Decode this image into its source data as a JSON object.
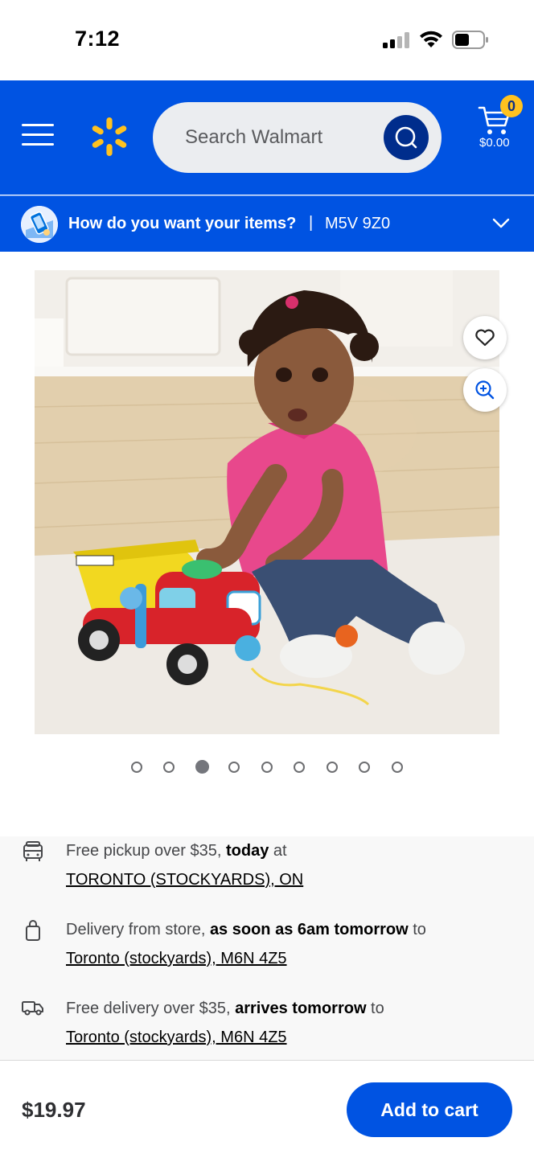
{
  "status_bar": {
    "time": "7:12",
    "battery_level": 0.5
  },
  "header": {
    "search_placeholder": "Search Walmart",
    "cart_count": "0",
    "cart_total": "$0.00",
    "brand_color": "#0053e2",
    "spark_color": "#ffc220"
  },
  "intent": {
    "question": "How do you want your items?",
    "separator": "|",
    "postal_code": "M5V 9Z0"
  },
  "carousel": {
    "total": 9,
    "active_index": 3
  },
  "fulfillment": [
    {
      "icon": "store-pickup-icon",
      "prefix": "Free pickup over $35, ",
      "bold": "today",
      "suffix": " at",
      "link": "TORONTO (STOCKYARDS), ON"
    },
    {
      "icon": "shopping-bag-icon",
      "prefix": "Delivery from store, ",
      "bold": "as soon as 6am tomorrow",
      "suffix": " to",
      "link": "Toronto (stockyards), M6N 4Z5"
    },
    {
      "icon": "delivery-truck-icon",
      "prefix": "Free delivery over $35, ",
      "bold": "arrives tomorrow",
      "suffix": " to",
      "link": "Toronto (stockyards), M6N 4Z5"
    }
  ],
  "bottom": {
    "price": "$19.97",
    "add_to_cart": "Add to cart"
  }
}
